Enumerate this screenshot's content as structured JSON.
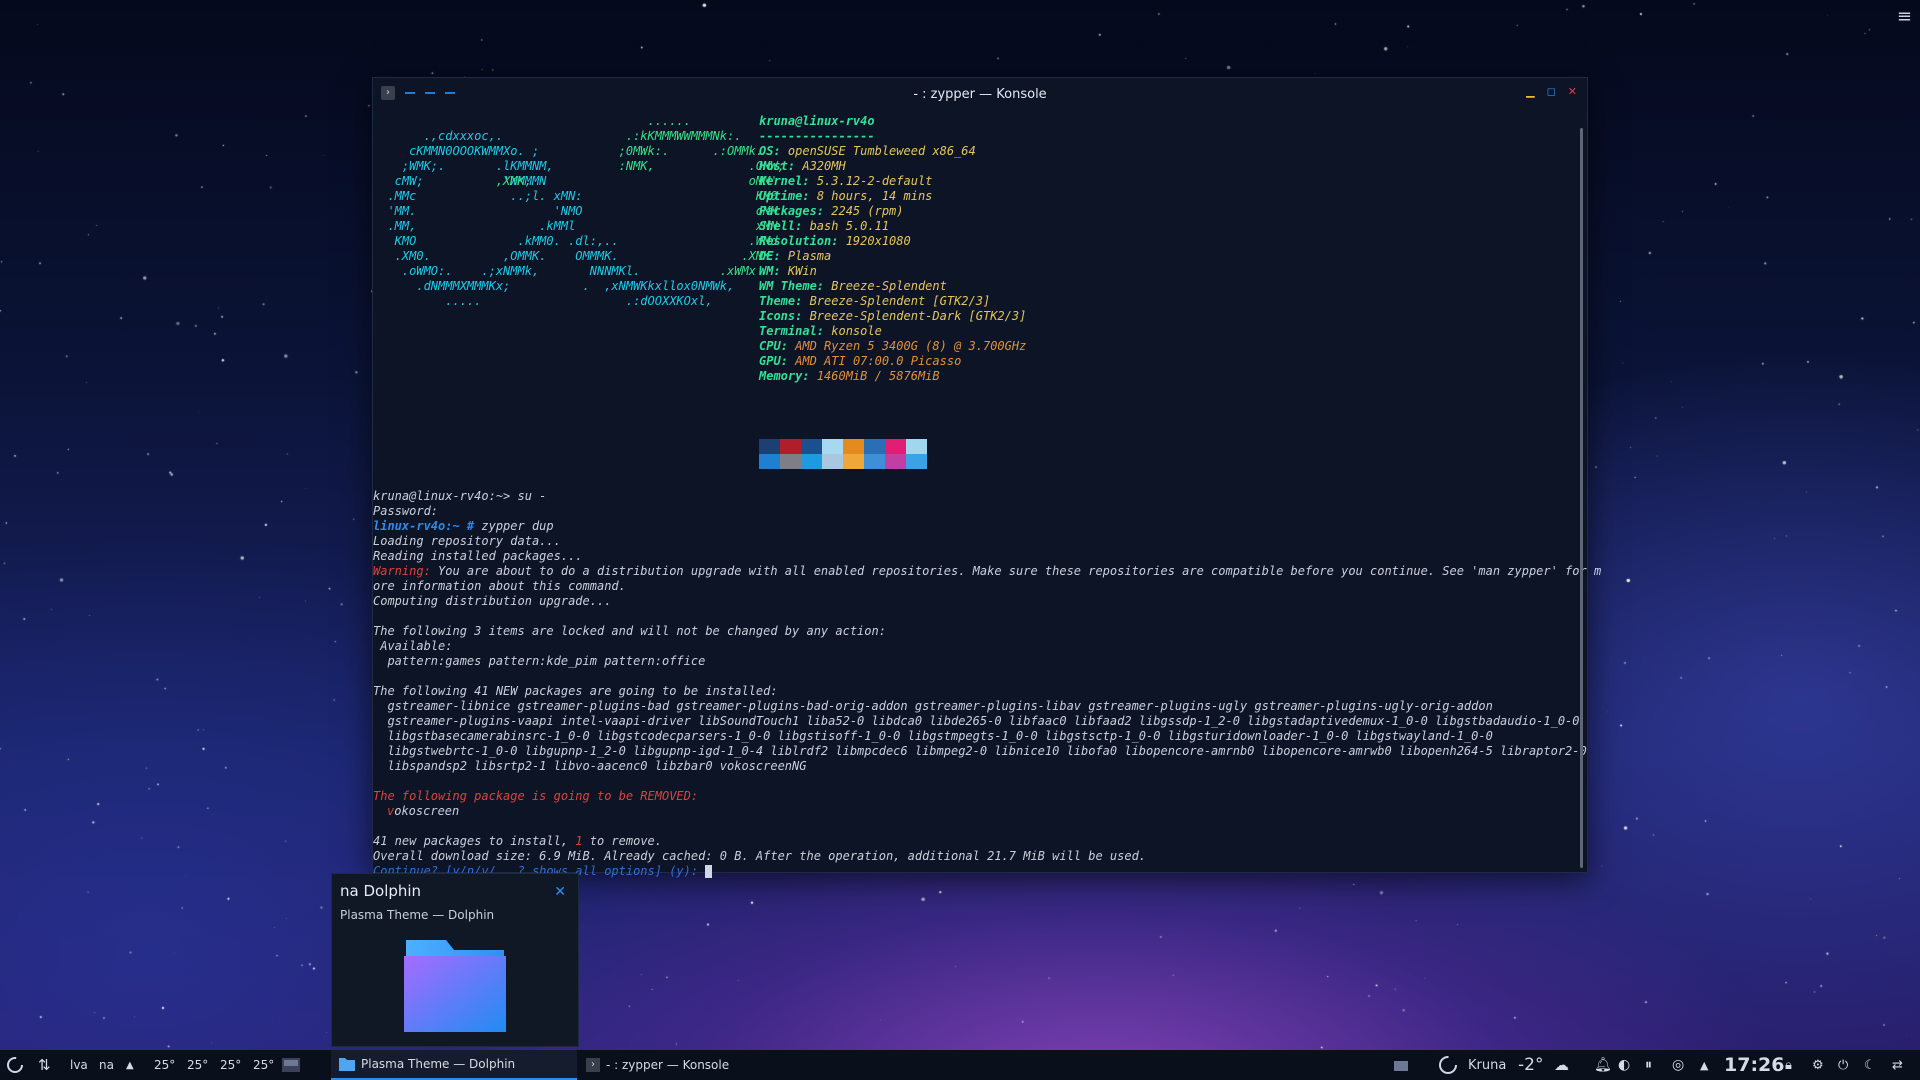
{
  "window": {
    "title": "- : zypper — Konsole"
  },
  "neofetch": {
    "logo_lines_blue": [
      "       .,cdxxxoc,.",
      "     cKMMN0OOOKWMMXo. ;",
      "    ;WMK;.       .lKMMNM,",
      "   cMW;           'WMMMN",
      "  .MMc             ..;l. xMN:",
      "  'MM.                   'NMO",
      "  .MM,                 .kMMl",
      "   KMO              .kMM0. .dl:,..",
      "   .XM0.          ,OMMK.    OMMMK.",
      "    .oWMO:.    .;xNMMk,       NNNMKl.",
      "      .dNMMMXMMMKx;          .  ,xNMWKkxllox0NMWk,",
      "          .....                    .:dOOXXKOxl,"
    ],
    "logo_lines_green": [
      "                                      ......",
      "                                   .:kKMMMWWMMMNk:.",
      "                                  ;0MWk:.      .:OMMk.",
      "                                  :NMK,             .OMW;",
      "                 ,XMK,                              oMM'",
      "                                                     KM0",
      "                                                     oMM",
      "                                                     xMN",
      "                                                    .WMd",
      "                                                   .XMK",
      "                                                .xWMx",
      ""
    ],
    "user_host": "kruna@linux-rv4o",
    "separator": "----------------",
    "info": [
      {
        "label": "OS",
        "value": "openSUSE Tumbleweed x86_64"
      },
      {
        "label": "Host",
        "value": "A320MH"
      },
      {
        "label": "Kernel",
        "value": "5.3.12-2-default"
      },
      {
        "label": "Uptime",
        "value": "8 hours, 14 mins"
      },
      {
        "label": "Packages",
        "value": "2245 (rpm)"
      },
      {
        "label": "Shell",
        "value": "bash 5.0.11"
      },
      {
        "label": "Resolution",
        "value": "1920x1080"
      },
      {
        "label": "DE",
        "value": "Plasma"
      },
      {
        "label": "WM",
        "value": "KWin"
      },
      {
        "label": "WM Theme",
        "value": "Breeze-Splendent"
      },
      {
        "label": "Theme",
        "value": "Breeze-Splendent [GTK2/3]"
      },
      {
        "label": "Icons",
        "value": "Breeze-Splendent-Dark [GTK2/3]"
      },
      {
        "label": "Terminal",
        "value": "konsole"
      },
      {
        "label": "CPU",
        "value": "AMD Ryzen 5 3400G (8) @ 3.700GHz"
      },
      {
        "label": "GPU",
        "value": "AMD ATI 07:00.0 Picasso"
      },
      {
        "label": "Memory",
        "value": "1460MiB / 5876MiB"
      }
    ],
    "palette": [
      "#1d3f73",
      "#b01e2b",
      "#1b4f8d",
      "#a6d8ef",
      "#e58a1f",
      "#2a6fb6",
      "#e01e74",
      "#9fd7ef",
      "#1f7fd1",
      "#7e7f86",
      "#1d9ae0",
      "#a9c8e0",
      "#f0a73a",
      "#3e8fd8",
      "#c03fa1",
      "#3aa3e6",
      "#1f8fe0"
    ]
  },
  "terminal": {
    "cmd1_prompt": "kruna@linux-rv4o:~> ",
    "cmd1": "su -",
    "password": "Password:",
    "root_prompt": "linux-rv4o:~ # ",
    "cmd2": "zypper dup",
    "loading": "Loading repository data...",
    "reading": "Reading installed packages...",
    "warning_label": "Warning:",
    "warning_text": " You are about to do a distribution upgrade with all enabled repositories. Make sure these repositories are compatible before you continue. See 'man zypper' for m",
    "warning_cont": "ore information about this command.",
    "computing": "Computing distribution upgrade...",
    "locked_head": "The following 3 items are locked and will not be changed by any action:",
    "available": " Available:",
    "locked_items": "  pattern:games pattern:kde_pim pattern:office",
    "new_head": "The following 41 NEW packages are going to be installed:",
    "new_pkgs": [
      "  gstreamer-libnice gstreamer-plugins-bad gstreamer-plugins-bad-orig-addon gstreamer-plugins-libav gstreamer-plugins-ugly gstreamer-plugins-ugly-orig-addon",
      "  gstreamer-plugins-vaapi intel-vaapi-driver libSoundTouch1 liba52-0 libdca0 libde265-0 libfaac0 libfaad2 libgssdp-1_2-0 libgstadaptivedemux-1_0-0 libgstbadaudio-1_0-0",
      "  libgstbasecamerabinsrc-1_0-0 libgstcodecparsers-1_0-0 libgstisoff-1_0-0 libgstmpegts-1_0-0 libgstsctp-1_0-0 libgsturidownloader-1_0-0 libgstwayland-1_0-0",
      "  libgstwebrtc-1_0-0 libgupnp-1_2-0 libgupnp-igd-1_0-4 liblrdf2 libmpcdec6 libmpeg2-0 libnice10 libofa0 libopencore-amrnb0 libopencore-amrwb0 libopenh264-5 libraptor2-0",
      "  libspandsp2 libsrtp2-1 libvo-aacenc0 libzbar0 vokoscreenNG"
    ],
    "remove_head": "The following package is going to be REMOVED:",
    "remove_pkg_first": "v",
    "remove_pkg_rest": "okoscreen",
    "summary_a": "41 new packages to install, ",
    "summary_num": "1",
    "summary_b": " to remove.",
    "download": "Overall download size: 6.9 MiB. Already cached: 0 B. After the operation, additional 21.7 MiB will be used.",
    "continue": "Continue? [y/n/v/...? shows all options] (y): "
  },
  "tooltip": {
    "title": "na Dolphin",
    "subtitle": "Plasma Theme — Dolphin"
  },
  "taskbar": {
    "lva": "lva",
    "na": "na",
    "temps": [
      "25°",
      "25°",
      "25°",
      "25°"
    ],
    "task_dolphin": "Plasma Theme — Dolphin",
    "task_konsole": "- : zypper — Konsole",
    "user": "Kruna",
    "weather_temp": "-2°",
    "clock": "17:26"
  }
}
